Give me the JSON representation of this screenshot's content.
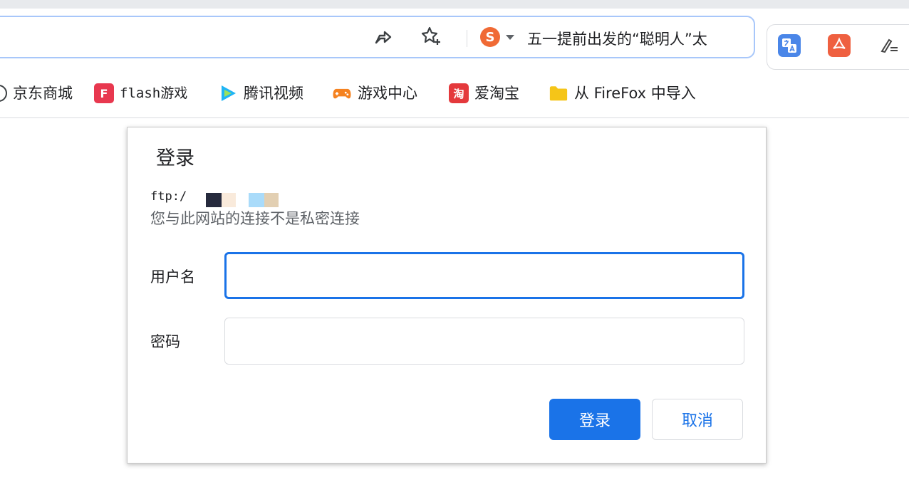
{
  "browser": {
    "omnibox": {
      "suggestion_text": "五一提前出发的“聪明人”太"
    },
    "icons": {
      "share": "share-arrow-icon",
      "bookmark_star": "bookmark-star-icon",
      "search_engine": "sogou-search-icon",
      "translate": "translate-extension-icon",
      "pdf": "pdf-extension-icon",
      "edit": "edit-extension-icon"
    },
    "bookmarks": [
      {
        "label": "京东商城",
        "icon": "jd-icon"
      },
      {
        "label": "flash游戏",
        "icon": "flash-game-icon"
      },
      {
        "label": "腾讯视频",
        "icon": "tencent-video-icon"
      },
      {
        "label": "游戏中心",
        "icon": "gamepad-icon"
      },
      {
        "label": "爱淘宝",
        "icon": "taobao-icon"
      },
      {
        "label": "从 FireFox 中导入",
        "icon": "folder-icon"
      }
    ]
  },
  "dialog": {
    "title": "登录",
    "url": "ftp:/",
    "warning": "您与此网站的连接不是私密连接",
    "username_label": "用户名",
    "username_value": "",
    "password_label": "密码",
    "password_value": "",
    "login_button": "登录",
    "cancel_button": "取消"
  },
  "colors": {
    "accent": "#1a73e8",
    "omnibox_border": "#a8c7fa",
    "sogou": "#f06a35",
    "taobao": "#e4393c",
    "folder": "#f5c518"
  }
}
